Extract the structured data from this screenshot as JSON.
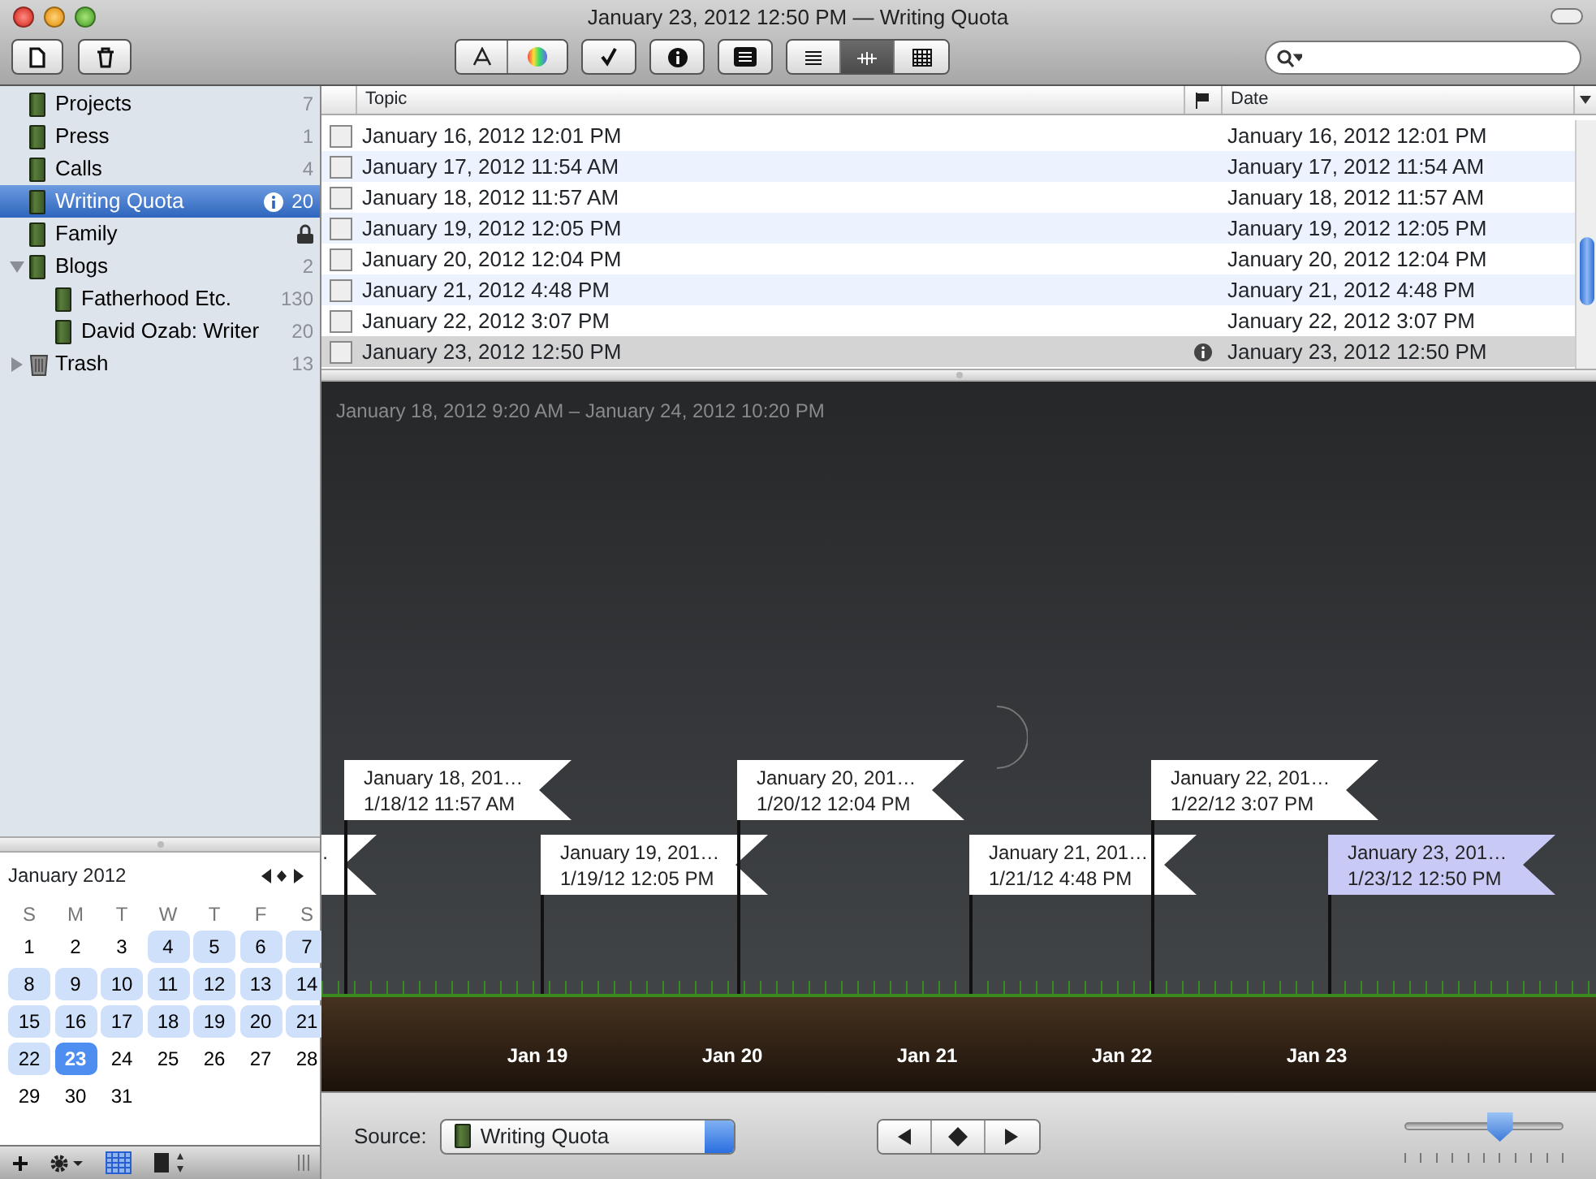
{
  "window": {
    "title": "January 23, 2012 12:50 PM — Writing Quota"
  },
  "view_modes": [
    {
      "kind": "list",
      "selected": false
    },
    {
      "kind": "timeline",
      "selected": true
    },
    {
      "kind": "calendar",
      "selected": false
    }
  ],
  "sidebar": {
    "items": [
      {
        "label": "Projects",
        "count": "7",
        "kind": "notebook",
        "selected": false,
        "info": false,
        "locked": false
      },
      {
        "label": "Press",
        "count": "1",
        "kind": "notebook",
        "selected": false,
        "info": false,
        "locked": false
      },
      {
        "label": "Calls",
        "count": "4",
        "kind": "notebook",
        "selected": false,
        "info": false,
        "locked": false
      },
      {
        "label": "Writing Quota",
        "count": "20",
        "kind": "notebook",
        "selected": true,
        "info": true,
        "locked": false
      },
      {
        "label": "Family",
        "kind": "notebook",
        "selected": false,
        "info": false,
        "locked": true
      },
      {
        "label": "Blogs",
        "count": "2",
        "kind": "notebook",
        "selected": false,
        "info": false,
        "locked": false,
        "expanded": true,
        "children": [
          {
            "label": "Fatherhood Etc.",
            "count": "130",
            "kind": "notebook",
            "selected": false,
            "info": false,
            "locked": false
          },
          {
            "label": "David Ozab: Writer",
            "count": "20",
            "kind": "notebook",
            "selected": false,
            "info": false,
            "locked": false
          }
        ]
      },
      {
        "label": "Trash",
        "count": "13",
        "kind": "trash",
        "selected": false,
        "info": false,
        "locked": false,
        "expanded": false
      }
    ]
  },
  "calendar": {
    "month": "January 2012",
    "weekdays": [
      "S",
      "M",
      "T",
      "W",
      "T",
      "F",
      "S"
    ],
    "days": [
      {
        "label": "1",
        "has_entries": false,
        "selected": false
      },
      {
        "label": "2",
        "has_entries": false,
        "selected": false
      },
      {
        "label": "3",
        "has_entries": false,
        "selected": false
      },
      {
        "label": "4",
        "has_entries": true,
        "selected": false
      },
      {
        "label": "5",
        "has_entries": true,
        "selected": false
      },
      {
        "label": "6",
        "has_entries": true,
        "selected": false
      },
      {
        "label": "7",
        "has_entries": true,
        "selected": false
      },
      {
        "label": "8",
        "has_entries": true,
        "selected": false
      },
      {
        "label": "9",
        "has_entries": true,
        "selected": false
      },
      {
        "label": "10",
        "has_entries": true,
        "selected": false
      },
      {
        "label": "11",
        "has_entries": true,
        "selected": false
      },
      {
        "label": "12",
        "has_entries": true,
        "selected": false
      },
      {
        "label": "13",
        "has_entries": true,
        "selected": false
      },
      {
        "label": "14",
        "has_entries": true,
        "selected": false
      },
      {
        "label": "15",
        "has_entries": true,
        "selected": false
      },
      {
        "label": "16",
        "has_entries": true,
        "selected": false
      },
      {
        "label": "17",
        "has_entries": true,
        "selected": false
      },
      {
        "label": "18",
        "has_entries": true,
        "selected": false
      },
      {
        "label": "19",
        "has_entries": true,
        "selected": false
      },
      {
        "label": "20",
        "has_entries": true,
        "selected": false
      },
      {
        "label": "21",
        "has_entries": true,
        "selected": false
      },
      {
        "label": "22",
        "has_entries": true,
        "selected": false
      },
      {
        "label": "23",
        "has_entries": true,
        "selected": true
      },
      {
        "label": "24",
        "has_entries": false,
        "selected": false
      },
      {
        "label": "25",
        "has_entries": false,
        "selected": false
      },
      {
        "label": "26",
        "has_entries": false,
        "selected": false
      },
      {
        "label": "27",
        "has_entries": false,
        "selected": false
      },
      {
        "label": "28",
        "has_entries": false,
        "selected": false
      },
      {
        "label": "29",
        "has_entries": false,
        "selected": false
      },
      {
        "label": "30",
        "has_entries": false,
        "selected": false
      },
      {
        "label": "31",
        "has_entries": false,
        "selected": false
      }
    ]
  },
  "table": {
    "columns": [
      "Topic",
      "Date"
    ],
    "rows": [
      {
        "topic": "January 16, 2012 12:01 PM",
        "date": "January 16, 2012 12:01 PM",
        "selected": false,
        "info": false
      },
      {
        "topic": "January 17, 2012 11:54 AM",
        "date": "January 17, 2012 11:54 AM",
        "selected": false,
        "info": false
      },
      {
        "topic": "January 18, 2012 11:57 AM",
        "date": "January 18, 2012 11:57 AM",
        "selected": false,
        "info": false
      },
      {
        "topic": "January 19, 2012 12:05 PM",
        "date": "January 19, 2012 12:05 PM",
        "selected": false,
        "info": false
      },
      {
        "topic": "January 20, 2012 12:04 PM",
        "date": "January 20, 2012 12:04 PM",
        "selected": false,
        "info": false
      },
      {
        "topic": "January 21, 2012 4:48 PM",
        "date": "January 21, 2012 4:48 PM",
        "selected": false,
        "info": false
      },
      {
        "topic": "January 22, 2012 3:07 PM",
        "date": "January 22, 2012 3:07 PM",
        "selected": false,
        "info": false
      },
      {
        "topic": "January 23, 2012 12:50 PM",
        "date": "January 23, 2012 12:50 PM",
        "selected": true,
        "info": true
      }
    ]
  },
  "timeline": {
    "range": "January 18, 2012 9:20 AM – January 24, 2012 10:20 PM",
    "flags": [
      {
        "title": ".",
        "selected": false
      },
      {
        "title": "January 18, 201…",
        "time": "1/18/12 11:57 AM",
        "selected": false
      },
      {
        "title": "January 19, 201…",
        "time": "1/19/12 12:05 PM",
        "selected": false
      },
      {
        "title": "January 20, 201…",
        "time": "1/20/12 12:04 PM",
        "selected": false
      },
      {
        "title": "January 21, 201…",
        "time": "1/21/12 4:48 PM",
        "selected": false
      },
      {
        "title": "January 22, 201…",
        "time": "1/22/12 3:07 PM",
        "selected": false
      },
      {
        "title": "January 23, 201…",
        "time": "1/23/12 12:50 PM",
        "selected": true
      }
    ],
    "axis_labels": [
      "Jan 19",
      "Jan 20",
      "Jan 21",
      "Jan 22",
      "Jan 23"
    ]
  },
  "footer": {
    "source_label": "Source:",
    "source": "Writing Quota",
    "zoom": {
      "level": 0.6
    }
  }
}
